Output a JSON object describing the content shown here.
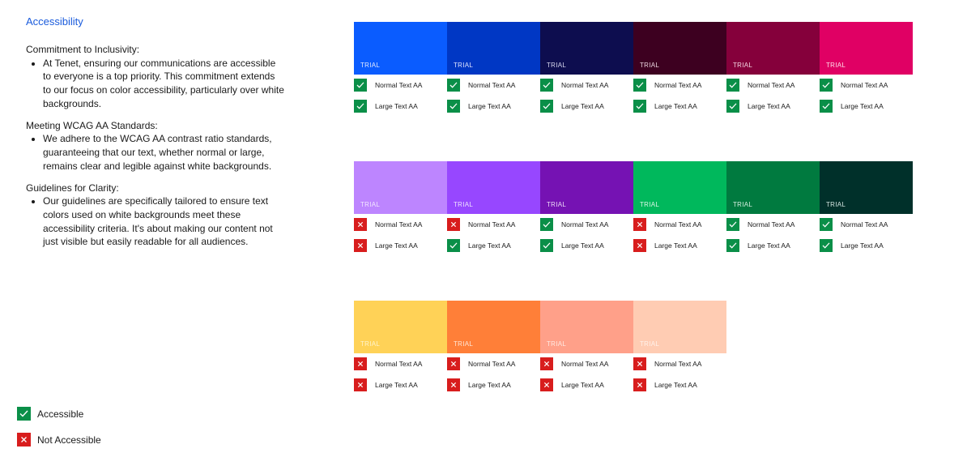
{
  "page": {
    "title": "Accessibility"
  },
  "sections": [
    {
      "heading": "Commitment to Inclusivity:",
      "bullet": "At Tenet, ensuring our communications are accessible to everyone is a top priority. This commitment extends to our focus on color accessibility, particularly over white backgrounds."
    },
    {
      "heading": "Meeting WCAG AA Standards:",
      "bullet": "We adhere to the WCAG AA contrast ratio standards, guaranteeing that our text, whether normal or large, remains clear and legible against white backgrounds."
    },
    {
      "heading": "Guidelines for Clarity:",
      "bullet": "Our guidelines are specifically tailored to ensure text colors used on white backgrounds meet these accessibility criteria. It's about making our content not just visible but easily readable for all audiences."
    }
  ],
  "labels": {
    "swatch": "TRIAL",
    "normal": "Normal Text AA",
    "large": "Large Text AA"
  },
  "palettes": [
    {
      "swatches": [
        {
          "color": "#0a5cff",
          "text_color": "#dfe7ff",
          "normal": true,
          "large": true
        },
        {
          "color": "#0037c4",
          "text_color": "#dfe4ff",
          "normal": true,
          "large": true
        },
        {
          "color": "#0d0d4f",
          "text_color": "#d8d8ee",
          "normal": true,
          "large": true
        },
        {
          "color": "#3d0020",
          "text_color": "#ecd6df",
          "normal": true,
          "large": true
        },
        {
          "color": "#85003b",
          "text_color": "#f5d7e3",
          "normal": true,
          "large": true
        },
        {
          "color": "#e00064",
          "text_color": "#ffe0ec",
          "normal": true,
          "large": true
        }
      ]
    },
    {
      "swatches": [
        {
          "color": "#bd85ff",
          "text_color": "#f3e6ff",
          "normal": false,
          "large": false
        },
        {
          "color": "#9747ff",
          "text_color": "#efe2ff",
          "normal": false,
          "large": true
        },
        {
          "color": "#7512b3",
          "text_color": "#ecdaf6",
          "normal": true,
          "large": true
        },
        {
          "color": "#00b85c",
          "text_color": "#dcf6e6",
          "normal": false,
          "large": false
        },
        {
          "color": "#007a3f",
          "text_color": "#d6efe1",
          "normal": true,
          "large": true
        },
        {
          "color": "#00302a",
          "text_color": "#d4e6e2",
          "normal": true,
          "large": true
        }
      ]
    },
    {
      "swatches": [
        {
          "color": "#ffd257",
          "text_color": "#fff4cc",
          "normal": false,
          "large": false
        },
        {
          "color": "#ff7f38",
          "text_color": "#ffe6d6",
          "normal": false,
          "large": false
        },
        {
          "color": "#ffa089",
          "text_color": "#ffe9e2",
          "normal": false,
          "large": false
        },
        {
          "color": "#ffccb3",
          "text_color": "#fff2eb",
          "normal": false,
          "large": false
        }
      ]
    }
  ],
  "legend": {
    "accessible": "Accessible",
    "not_accessible": "Not Accessible"
  },
  "colors": {
    "accent": "#1a5bdc",
    "pass": "#0a8f48",
    "fail": "#d81d1d"
  },
  "icons": {
    "pass": "check-icon",
    "fail": "cross-icon"
  }
}
